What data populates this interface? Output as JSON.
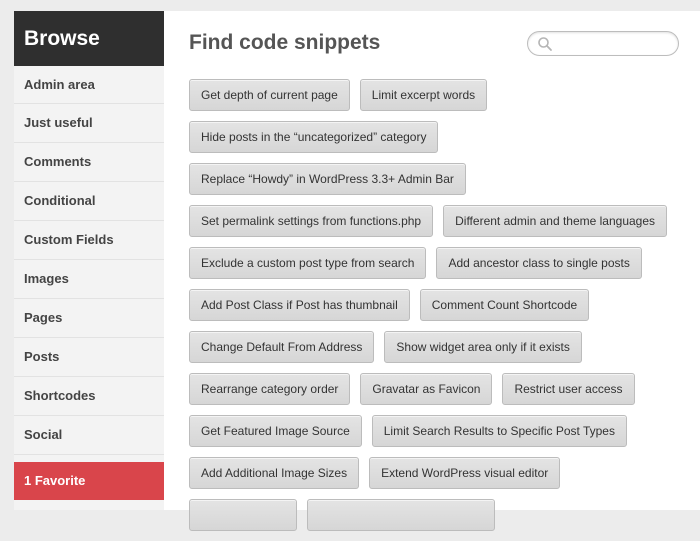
{
  "sidebar": {
    "title": "Browse",
    "items": [
      {
        "label": "Admin area"
      },
      {
        "label": "Just useful"
      },
      {
        "label": "Comments"
      },
      {
        "label": "Conditional"
      },
      {
        "label": "Custom Fields"
      },
      {
        "label": "Images"
      },
      {
        "label": "Pages"
      },
      {
        "label": "Posts"
      },
      {
        "label": "Shortcodes"
      },
      {
        "label": "Social"
      }
    ],
    "favorite_label": "1 Favorite"
  },
  "main": {
    "title": "Find code snippets",
    "search": {
      "placeholder": "",
      "value": ""
    },
    "rows": [
      [
        "Get depth of current page",
        "Limit excerpt words"
      ],
      [
        "Hide posts in the “uncategorized” category"
      ],
      [
        "Replace “Howdy” in WordPress 3.3+ Admin Bar"
      ],
      [
        "Set permalink settings from functions.php",
        "Different admin and theme languages"
      ],
      [
        "Exclude a custom post type from search",
        "Add ancestor class to single posts"
      ],
      [
        "Add Post Class if Post has thumbnail",
        "Comment Count Shortcode"
      ],
      [
        "Change Default From Address",
        "Show widget area only if it exists"
      ],
      [
        "Rearrange category order",
        "Gravatar as Favicon",
        "Restrict user access"
      ],
      [
        "Get Featured Image Source",
        "Limit Search Results to Specific Post Types"
      ],
      [
        "Add Additional Image Sizes",
        "Extend WordPress visual editor"
      ]
    ]
  },
  "colors": {
    "header_bg": "#2f2f2f",
    "favorite_bg": "#d9454b",
    "chip_bg": "#dddddd",
    "page_bg": "#ececec"
  },
  "icons": {
    "search": "search-icon"
  }
}
